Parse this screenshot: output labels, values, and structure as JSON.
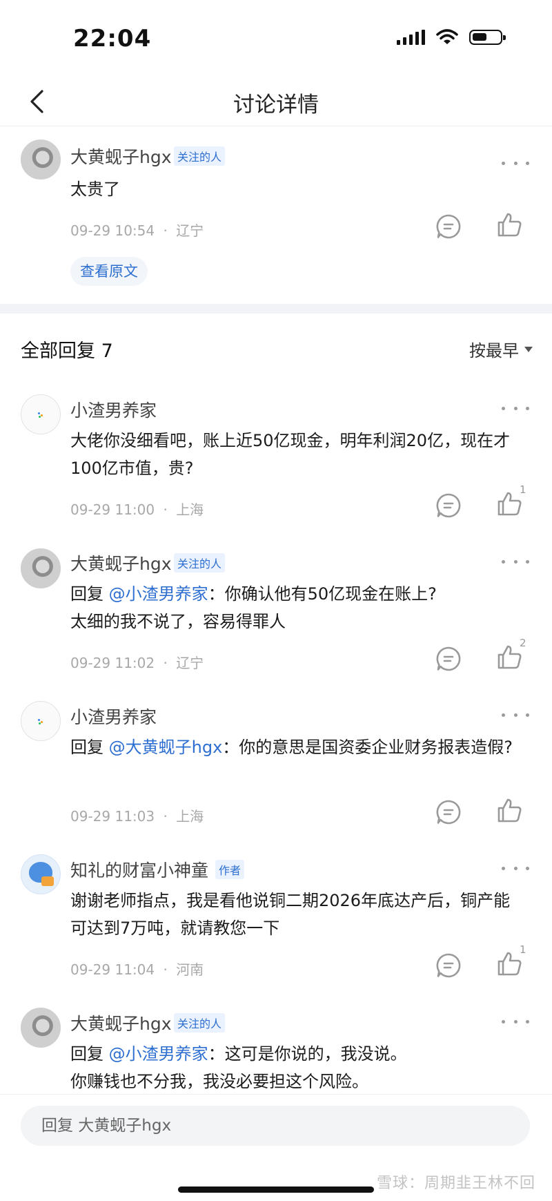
{
  "status_bar": {
    "time": "22:04"
  },
  "nav": {
    "title": "讨论详情"
  },
  "post": {
    "author": "大黄蚬子hgx",
    "badge": "关注的人",
    "text": "太贵了",
    "time": "09-29 10:54",
    "location": "辽宁",
    "view_original": "查看原文"
  },
  "replies_header": {
    "title": "全部回复 7",
    "sort": "按最早"
  },
  "replies": [
    {
      "author": "小渣男养家",
      "badge": "",
      "reply_prefix": "",
      "mention": "",
      "text": "大佬你没细看吧，账上近50亿现金，明年利润20亿，现在才100亿市值，贵?",
      "time": "09-29 11:00",
      "location": "上海",
      "likes": "1"
    },
    {
      "author": "大黄蚬子hgx",
      "badge": "关注的人",
      "reply_prefix": "回复 ",
      "mention": "@小渣男养家",
      "text": "：你确认他有50亿现金在账上?\n太细的我不说了，容易得罪人",
      "time": "09-29 11:02",
      "location": "辽宁",
      "likes": "2"
    },
    {
      "author": "小渣男养家",
      "badge": "",
      "reply_prefix": "回复 ",
      "mention": "@大黄蚬子hgx",
      "text": "：你的意思是国资委企业财务报表造假?",
      "time": "09-29 11:03",
      "location": "上海",
      "likes": ""
    },
    {
      "author": "知礼的财富小神童",
      "badge": "作者",
      "reply_prefix": "",
      "mention": "",
      "text": "谢谢老师指点，我是看他说铜二期2026年底达产后，铜产能可达到7万吨，就请教您一下",
      "time": "09-29 11:04",
      "location": "河南",
      "likes": "1"
    },
    {
      "author": "大黄蚬子hgx",
      "badge": "关注的人",
      "reply_prefix": "回复 ",
      "mention": "@小渣男养家",
      "text": "：这可是你说的，我没说。\n你赚钱也不分我，我没必要担这个风险。",
      "time": "",
      "location": "",
      "likes": ""
    }
  ],
  "reply_bar": {
    "placeholder": "回复 大黄蚬子hgx"
  },
  "watermark": "雪球：周期韭王林不回",
  "separator_dot": "·"
}
